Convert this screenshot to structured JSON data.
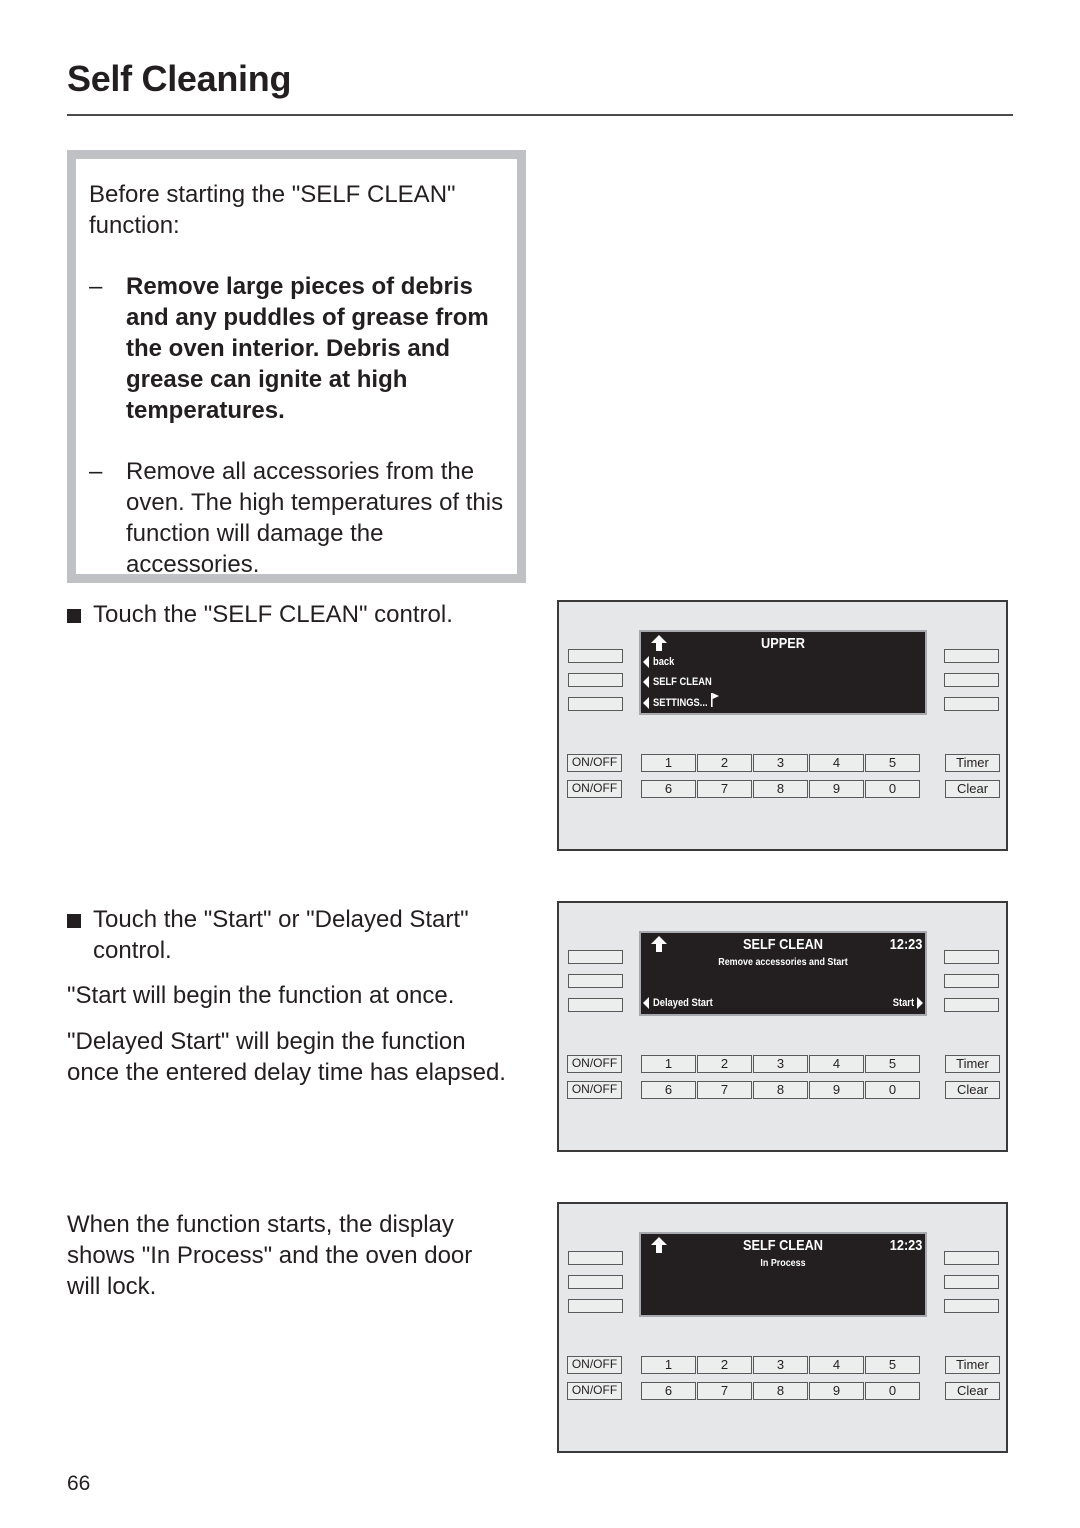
{
  "page": {
    "title": "Self Cleaning",
    "page_number": "66"
  },
  "warning": {
    "intro": "Before starting the \"SELF CLEAN\" function:",
    "items": [
      {
        "dash": "–",
        "text": "Remove large pieces of debris and any puddles of grease from the oven interior. Debris and grease can ignite at high temperatures.",
        "bold": true
      },
      {
        "dash": "–",
        "text": "Remove all accessories from the oven. The high temperatures of this function will damage the accessories.",
        "bold": false
      }
    ]
  },
  "steps": [
    {
      "text": "Touch the \"SELF CLEAN\" control."
    },
    {
      "text": "Touch the \"Start\" or \"Delayed Start\" control."
    }
  ],
  "paragraphs": [
    "\"Start will begin the function at once.",
    "\"Delayed Start\" will begin the function once the entered delay time has elapsed.",
    "When the function starts, the display shows \"In Process\" and the oven door will lock."
  ],
  "keypad": {
    "onoff": [
      "ON/OFF",
      "ON/OFF"
    ],
    "row1": [
      "1",
      "2",
      "3",
      "4",
      "5"
    ],
    "row2": [
      "6",
      "7",
      "8",
      "9",
      "0"
    ],
    "timer": "Timer",
    "clear": "Clear"
  },
  "panels": [
    {
      "display": {
        "title": "UPPER",
        "menu": [
          "back",
          "SELF CLEAN",
          "SETTINGS..."
        ]
      }
    },
    {
      "display": {
        "title": "SELF CLEAN",
        "time": "12:23",
        "subtitle": "Remove accessories and Start",
        "left_action": "Delayed Start",
        "right_action": "Start"
      }
    },
    {
      "display": {
        "title": "SELF CLEAN",
        "time": "12:23",
        "subtitle": "In Process"
      }
    }
  ]
}
